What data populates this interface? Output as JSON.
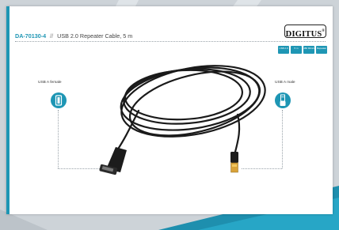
{
  "brand": {
    "logo_text": "DIGITUS",
    "logo_mark": "®"
  },
  "header": {
    "model": "DA-70130-4",
    "separator": "//",
    "product": "USB 2.0 Repeater Cable, 5 m"
  },
  "connectors": {
    "left_label": "USB A female",
    "right_label": "USB A male"
  },
  "badges": [
    {
      "icon": "usb-icon",
      "text": "USB 2.0"
    },
    {
      "icon": "cable-icon",
      "text": "5 m"
    },
    {
      "icon": "speed-icon",
      "text": "480 Mbit/s"
    },
    {
      "icon": "repeater-icon",
      "text": "Repeater"
    }
  ],
  "colors": {
    "accent": "#1e96b4",
    "background": "#cdd3d8",
    "card": "#ffffff",
    "cable": "#1a1a1a"
  }
}
